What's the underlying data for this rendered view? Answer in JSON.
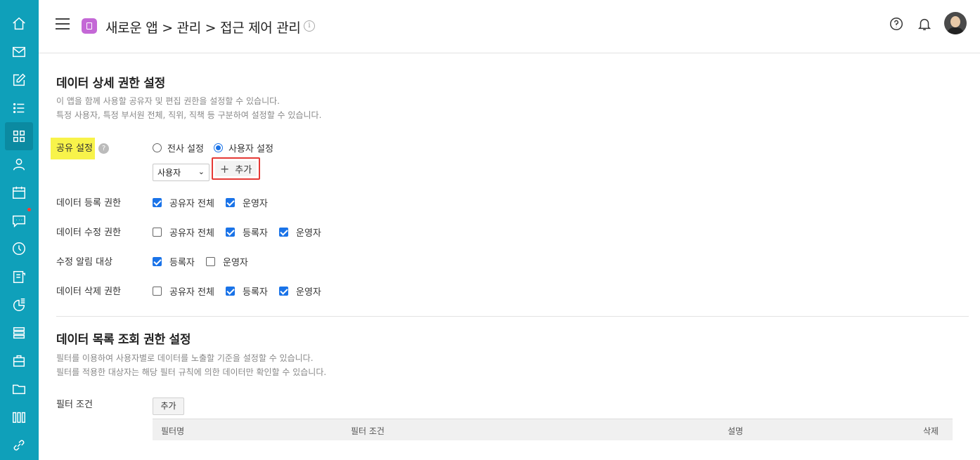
{
  "header": {
    "breadcrumb": "새로운 앱 > 관리 > 접근 제어 관리",
    "info_icon": "i"
  },
  "sidebar": {
    "items": [
      {
        "icon": "home-icon"
      },
      {
        "icon": "mail-icon"
      },
      {
        "icon": "edit-icon"
      },
      {
        "icon": "list-icon"
      },
      {
        "icon": "grid-icon",
        "active": true
      },
      {
        "icon": "person-icon"
      },
      {
        "icon": "calendar-icon"
      },
      {
        "icon": "chat-icon",
        "badge": true
      },
      {
        "icon": "clock-icon"
      },
      {
        "icon": "board-icon"
      },
      {
        "icon": "report-icon"
      },
      {
        "icon": "stack-icon"
      },
      {
        "icon": "briefcase-icon"
      },
      {
        "icon": "folder-icon"
      },
      {
        "icon": "books-icon"
      },
      {
        "icon": "link-icon"
      }
    ]
  },
  "section1": {
    "title": "데이터 상세 권한 설정",
    "desc_line1": "이 앱을 함께 사용할 공유자 및 편집 권한을 설정할 수 있습니다.",
    "desc_line2": "특정 사용자, 특정 부서원 전체, 직위, 직책 등 구분하여 설정할 수 있습니다."
  },
  "share": {
    "label": "공유 설정",
    "help": "?",
    "radio_all": "전사 설정",
    "radio_user": "사용자 설정",
    "selected": "사용자 설정",
    "select_value": "사용자",
    "add_label": "추가"
  },
  "permissions": {
    "register": {
      "label": "데이터 등록 권한",
      "options": [
        {
          "label": "공유자 전체",
          "checked": true
        },
        {
          "label": "운영자",
          "checked": true
        }
      ]
    },
    "edit": {
      "label": "데이터 수정 권한",
      "options": [
        {
          "label": "공유자 전체",
          "checked": false
        },
        {
          "label": "등록자",
          "checked": true
        },
        {
          "label": "운영자",
          "checked": true
        }
      ]
    },
    "notify": {
      "label": "수정 알림 대상",
      "options": [
        {
          "label": "등록자",
          "checked": true
        },
        {
          "label": "운영자",
          "checked": false
        }
      ]
    },
    "delete": {
      "label": "데이터 삭제 권한",
      "options": [
        {
          "label": "공유자 전체",
          "checked": false
        },
        {
          "label": "등록자",
          "checked": true
        },
        {
          "label": "운영자",
          "checked": true
        }
      ]
    }
  },
  "section2": {
    "title": "데이터 목록 조회 권한 설정",
    "desc_line1": "필터를 이용하여 사용자별로 데이터를 노출할 기준을 설정할 수 있습니다.",
    "desc_line2": "필터를 적용한 대상자는 해당 필터 규칙에 의한 데이터만 확인할 수 있습니다."
  },
  "filter": {
    "label": "필터 조건",
    "add_label": "추가",
    "columns": [
      "필터명",
      "필터 조건",
      "설명",
      "삭제"
    ]
  },
  "colors": {
    "sidebar": "#0fa0ba",
    "accent": "#1a73e8",
    "highlight": "#f8f34a",
    "focus_border": "#e53935"
  }
}
